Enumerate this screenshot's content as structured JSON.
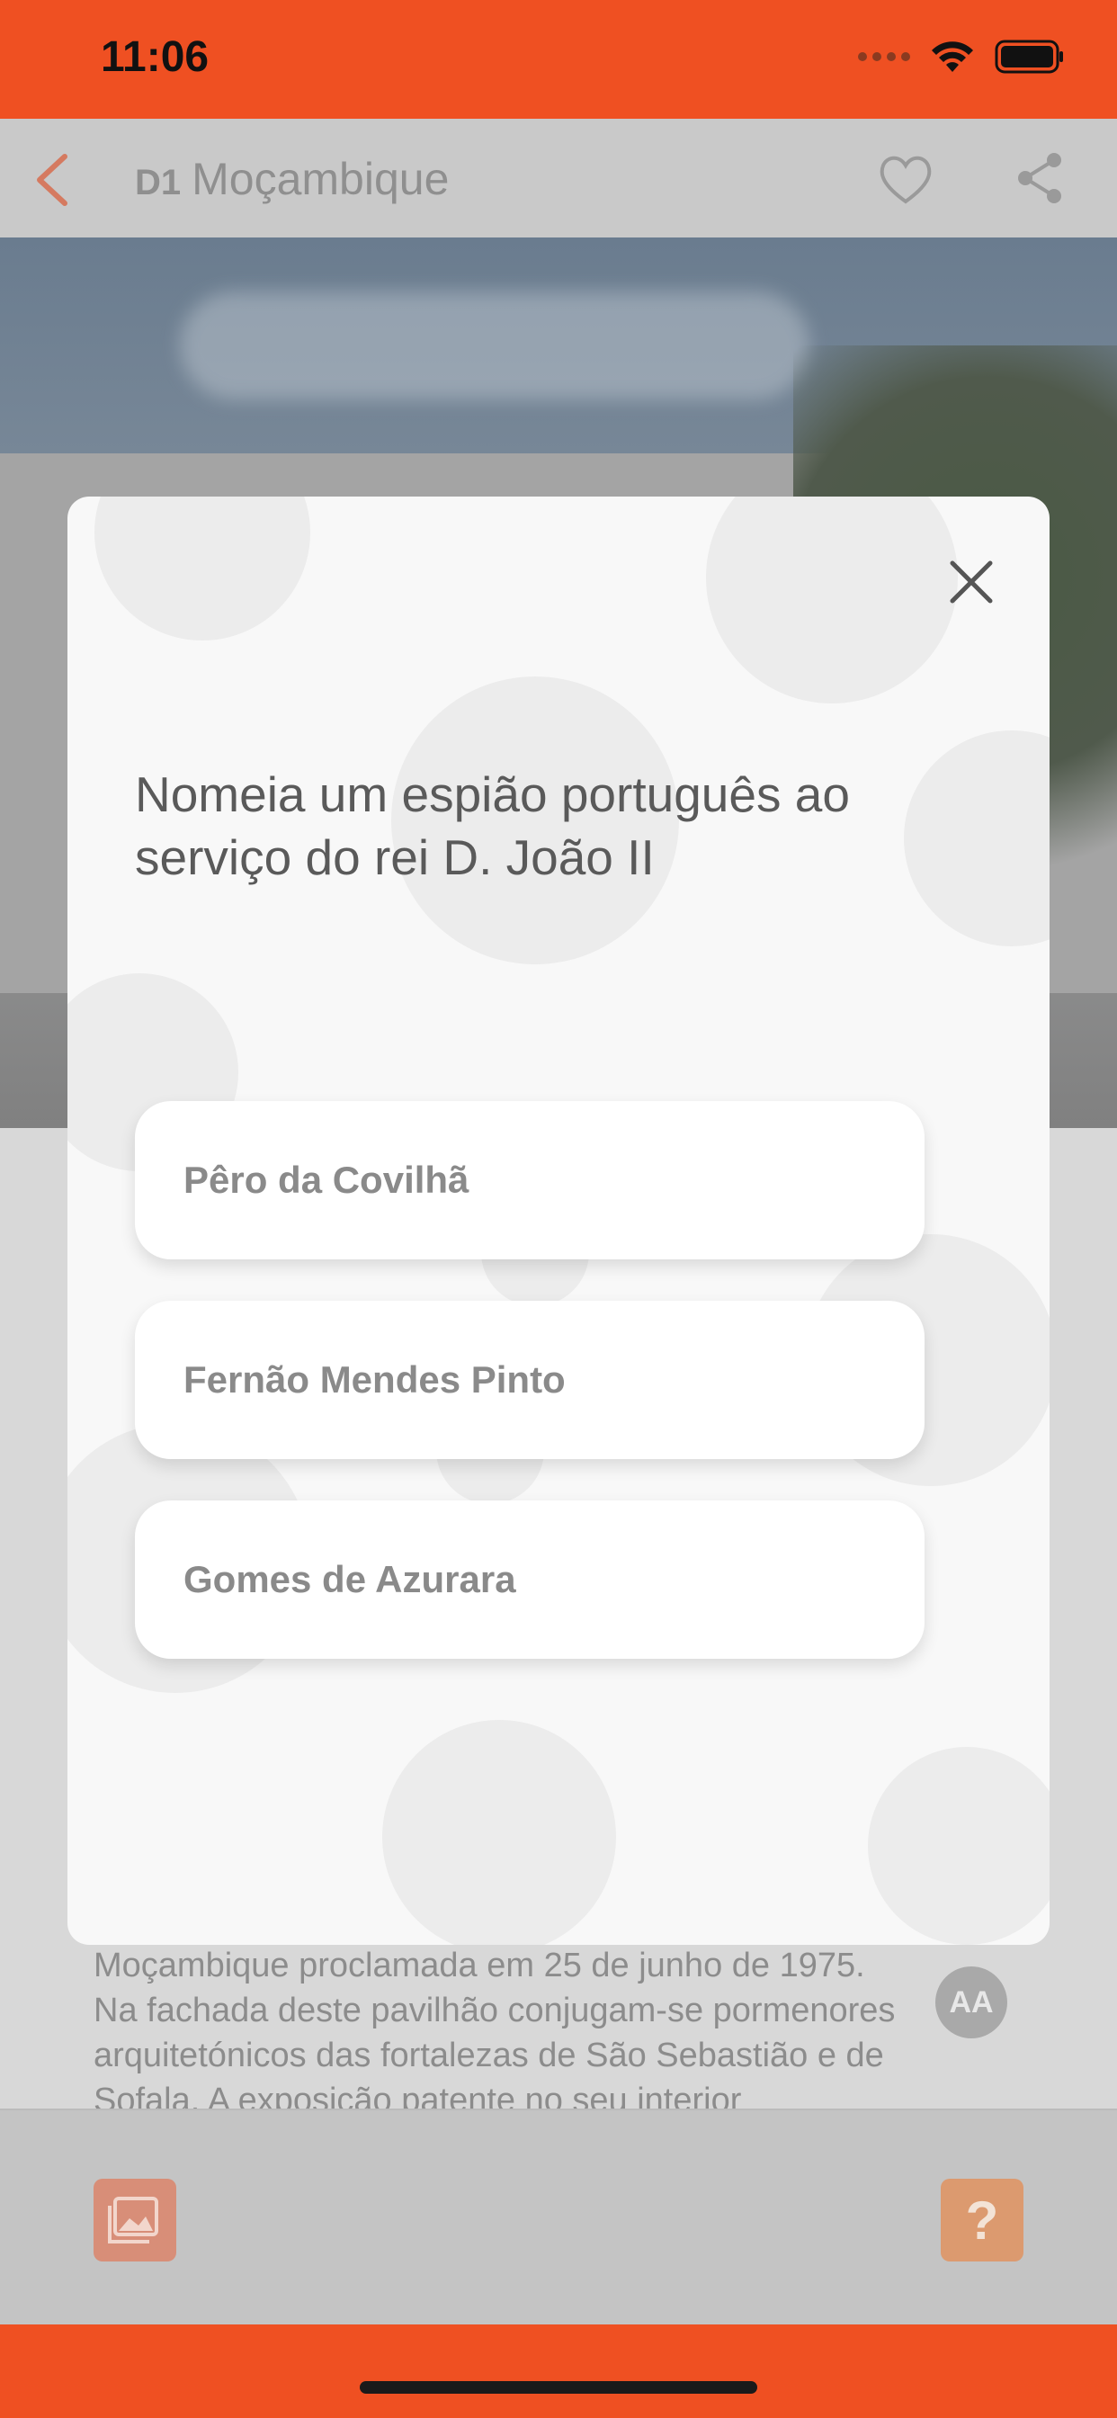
{
  "status_bar": {
    "time": "11:06"
  },
  "header": {
    "code": "D1",
    "title": "Moçambique"
  },
  "article": {
    "lines": [
      "Moçambique proclamada em 25 de junho de 1975.",
      "Na fachada deste pavilhão conjugam-se pormenores",
      "arquitetónicos das fortalezas de São Sebastião e de",
      "Sofala. A exposição patente no seu interior"
    ]
  },
  "text_size_button": {
    "label": "AA"
  },
  "quiz": {
    "question": "Nomeia um espião português ao serviço do rei D. João II",
    "answers": [
      {
        "label": "Pêro da Covilhã"
      },
      {
        "label": "Fernão Mendes Pinto"
      },
      {
        "label": "Gomes de Azurara"
      }
    ]
  },
  "bottom_bar": {
    "quiz_label": "?"
  },
  "colors": {
    "accent": "#ef5022",
    "overlay": "#c9c9c9",
    "modal": "#f8f8f8"
  }
}
